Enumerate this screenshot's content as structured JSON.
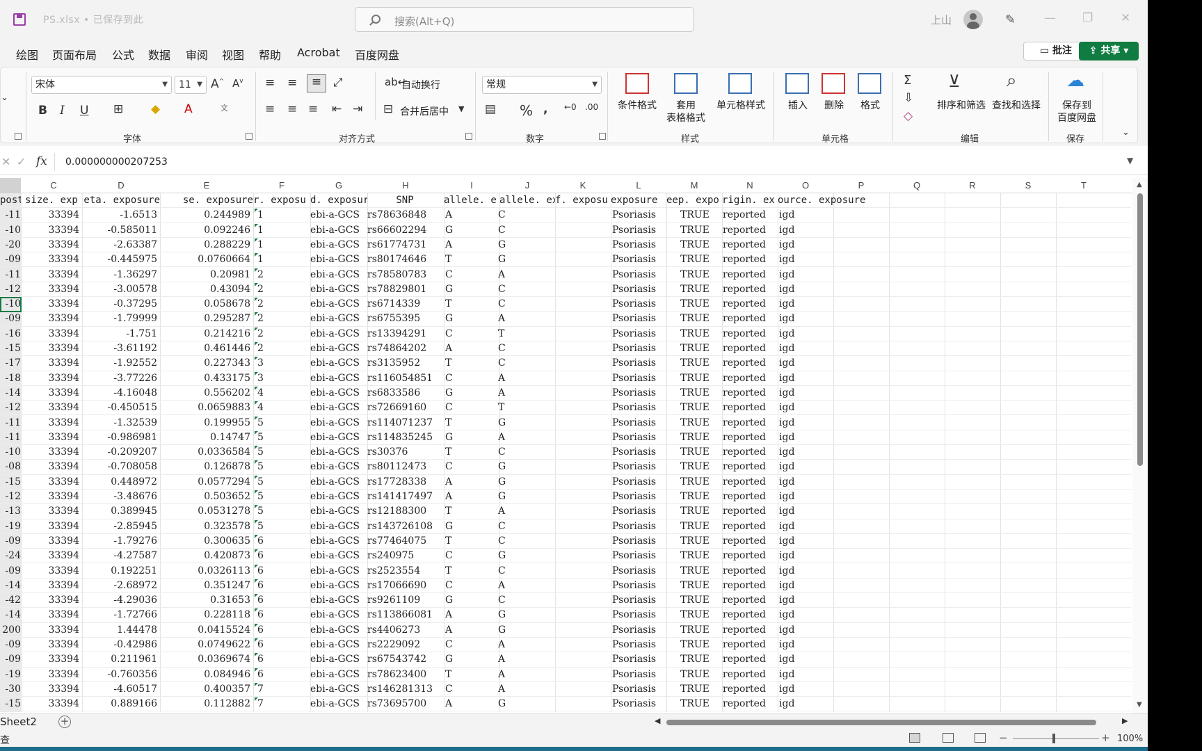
{
  "titlebar": {
    "file_title": "PS.xlsx • 已保存到此",
    "search_placeholder": "搜索(Alt+Q)",
    "user_name": "上山"
  },
  "menu": {
    "tabs": [
      "绘图",
      "页面布局",
      "公式",
      "数据",
      "审阅",
      "视图",
      "帮助",
      "Acrobat",
      "百度网盘"
    ],
    "comment_label": "批注",
    "share_label": "共享"
  },
  "ribbon": {
    "font_name": "宋体",
    "font_size": "11",
    "number_format": "常规",
    "wrap_text": "自动换行",
    "merge_center": "合并后居中",
    "conditional_format": "条件格式",
    "table_format_1": "套用",
    "table_format_2": "表格格式",
    "cell_styles": "单元格样式",
    "insert": "插入",
    "delete": "删除",
    "format": "格式",
    "sort_filter": "排序和筛选",
    "find_select": "查找和选择",
    "save_to_1": "保存到",
    "save_to_2": "百度网盘",
    "groups": {
      "font": "字体",
      "alignment": "对齐方式",
      "number": "数字",
      "styles": "样式",
      "cells": "单元格",
      "editing": "编辑",
      "save": "保存"
    }
  },
  "formula": {
    "value": "0.000000000207253"
  },
  "columns": [
    "C",
    "D",
    "E",
    "F",
    "G",
    "H",
    "I",
    "J",
    "K",
    "L",
    "M",
    "N",
    "O",
    "P",
    "Q",
    "R",
    "S",
    "T"
  ],
  "header_row": {
    "b": "poste",
    "c": "size. exp",
    "d": "eta. exposure",
    "e": "se. exposure",
    "f": "r. exposu",
    "g": "d. exposur",
    "h": "SNP",
    "i": "allele. e",
    "j": "allele. ex",
    "k": "f. exposu",
    "l": "exposure",
    "m": "eep. expo",
    "n": "rigin. ex",
    "o": "ource. exposure"
  },
  "rows": [
    [
      "-11",
      "33394",
      "-1.6513",
      "0.244989",
      "1",
      "ebi-a-GCS",
      "rs78636848",
      "A",
      "C",
      "Psoriasis",
      "TRUE",
      "reported",
      "igd"
    ],
    [
      "-10",
      "33394",
      "-0.585011",
      "0.092246",
      "1",
      "ebi-a-GCS",
      "rs66602294",
      "G",
      "C",
      "Psoriasis",
      "TRUE",
      "reported",
      "igd"
    ],
    [
      "-20",
      "33394",
      "-2.63387",
      "0.288229",
      "1",
      "ebi-a-GCS",
      "rs61774731",
      "A",
      "G",
      "Psoriasis",
      "TRUE",
      "reported",
      "igd"
    ],
    [
      "-09",
      "33394",
      "-0.445975",
      "0.0760664",
      "1",
      "ebi-a-GCS",
      "rs80174646",
      "T",
      "G",
      "Psoriasis",
      "TRUE",
      "reported",
      "igd"
    ],
    [
      "-11",
      "33394",
      "-1.36297",
      "0.20981",
      "2",
      "ebi-a-GCS",
      "rs78580783",
      "C",
      "A",
      "Psoriasis",
      "TRUE",
      "reported",
      "igd"
    ],
    [
      "-12",
      "33394",
      "-3.00578",
      "0.43094",
      "2",
      "ebi-a-GCS",
      "rs78829801",
      "G",
      "C",
      "Psoriasis",
      "TRUE",
      "reported",
      "igd"
    ],
    [
      "-10",
      "33394",
      "-0.37295",
      "0.058678",
      "2",
      "ebi-a-GCS",
      "rs6714339",
      "T",
      "C",
      "Psoriasis",
      "TRUE",
      "reported",
      "igd"
    ],
    [
      "-09",
      "33394",
      "-1.79999",
      "0.295287",
      "2",
      "ebi-a-GCS",
      "rs6755395",
      "G",
      "A",
      "Psoriasis",
      "TRUE",
      "reported",
      "igd"
    ],
    [
      "-16",
      "33394",
      "-1.751",
      "0.214216",
      "2",
      "ebi-a-GCS",
      "rs13394291",
      "C",
      "T",
      "Psoriasis",
      "TRUE",
      "reported",
      "igd"
    ],
    [
      "-15",
      "33394",
      "-3.61192",
      "0.461446",
      "2",
      "ebi-a-GCS",
      "rs74864202",
      "A",
      "C",
      "Psoriasis",
      "TRUE",
      "reported",
      "igd"
    ],
    [
      "-17",
      "33394",
      "-1.92552",
      "0.227343",
      "3",
      "ebi-a-GCS",
      "rs3135952",
      "T",
      "C",
      "Psoriasis",
      "TRUE",
      "reported",
      "igd"
    ],
    [
      "-18",
      "33394",
      "-3.77226",
      "0.433175",
      "3",
      "ebi-a-GCS",
      "rs116054851",
      "C",
      "A",
      "Psoriasis",
      "TRUE",
      "reported",
      "igd"
    ],
    [
      "-14",
      "33394",
      "-4.16048",
      "0.556202",
      "4",
      "ebi-a-GCS",
      "rs6833586",
      "G",
      "A",
      "Psoriasis",
      "TRUE",
      "reported",
      "igd"
    ],
    [
      "-12",
      "33394",
      "-0.450515",
      "0.0659883",
      "4",
      "ebi-a-GCS",
      "rs72669160",
      "C",
      "T",
      "Psoriasis",
      "TRUE",
      "reported",
      "igd"
    ],
    [
      "-11",
      "33394",
      "-1.32539",
      "0.199955",
      "5",
      "ebi-a-GCS",
      "rs114071237",
      "T",
      "G",
      "Psoriasis",
      "TRUE",
      "reported",
      "igd"
    ],
    [
      "-11",
      "33394",
      "-0.986981",
      "0.14747",
      "5",
      "ebi-a-GCS",
      "rs114835245",
      "G",
      "A",
      "Psoriasis",
      "TRUE",
      "reported",
      "igd"
    ],
    [
      "-10",
      "33394",
      "-0.209207",
      "0.0336584",
      "5",
      "ebi-a-GCS",
      "rs30376",
      "T",
      "C",
      "Psoriasis",
      "TRUE",
      "reported",
      "igd"
    ],
    [
      "-08",
      "33394",
      "-0.708058",
      "0.126878",
      "5",
      "ebi-a-GCS",
      "rs80112473",
      "C",
      "G",
      "Psoriasis",
      "TRUE",
      "reported",
      "igd"
    ],
    [
      "-15",
      "33394",
      "0.448972",
      "0.0577294",
      "5",
      "ebi-a-GCS",
      "rs17728338",
      "A",
      "G",
      "Psoriasis",
      "TRUE",
      "reported",
      "igd"
    ],
    [
      "-12",
      "33394",
      "-3.48676",
      "0.503652",
      "5",
      "ebi-a-GCS",
      "rs141417497",
      "A",
      "G",
      "Psoriasis",
      "TRUE",
      "reported",
      "igd"
    ],
    [
      "-13",
      "33394",
      "0.389945",
      "0.0531278",
      "5",
      "ebi-a-GCS",
      "rs12188300",
      "T",
      "A",
      "Psoriasis",
      "TRUE",
      "reported",
      "igd"
    ],
    [
      "-19",
      "33394",
      "-2.85945",
      "0.323578",
      "5",
      "ebi-a-GCS",
      "rs143726108",
      "G",
      "C",
      "Psoriasis",
      "TRUE",
      "reported",
      "igd"
    ],
    [
      "-09",
      "33394",
      "-1.79276",
      "0.300635",
      "6",
      "ebi-a-GCS",
      "rs77464075",
      "T",
      "C",
      "Psoriasis",
      "TRUE",
      "reported",
      "igd"
    ],
    [
      "-24",
      "33394",
      "-4.27587",
      "0.420873",
      "6",
      "ebi-a-GCS",
      "rs240975",
      "C",
      "G",
      "Psoriasis",
      "TRUE",
      "reported",
      "igd"
    ],
    [
      "-09",
      "33394",
      "0.192251",
      "0.0326113",
      "6",
      "ebi-a-GCS",
      "rs2523554",
      "T",
      "C",
      "Psoriasis",
      "TRUE",
      "reported",
      "igd"
    ],
    [
      "-14",
      "33394",
      "-2.68972",
      "0.351247",
      "6",
      "ebi-a-GCS",
      "rs17066690",
      "C",
      "A",
      "Psoriasis",
      "TRUE",
      "reported",
      "igd"
    ],
    [
      "-42",
      "33394",
      "-4.29036",
      "0.31653",
      "6",
      "ebi-a-GCS",
      "rs9261109",
      "G",
      "C",
      "Psoriasis",
      "TRUE",
      "reported",
      "igd"
    ],
    [
      "-14",
      "33394",
      "-1.72766",
      "0.228118",
      "6",
      "ebi-a-GCS",
      "rs113866081",
      "A",
      "G",
      "Psoriasis",
      "TRUE",
      "reported",
      "igd"
    ],
    [
      "200",
      "33394",
      "1.44478",
      "0.0415524",
      "6",
      "ebi-a-GCS",
      "rs4406273",
      "A",
      "G",
      "Psoriasis",
      "TRUE",
      "reported",
      "igd"
    ],
    [
      "-09",
      "33394",
      "-0.42986",
      "0.0749622",
      "6",
      "ebi-a-GCS",
      "rs2229092",
      "C",
      "A",
      "Psoriasis",
      "TRUE",
      "reported",
      "igd"
    ],
    [
      "-09",
      "33394",
      "0.211961",
      "0.0369674",
      "6",
      "ebi-a-GCS",
      "rs67543742",
      "G",
      "A",
      "Psoriasis",
      "TRUE",
      "reported",
      "igd"
    ],
    [
      "-19",
      "33394",
      "-0.760356",
      "0.084946",
      "6",
      "ebi-a-GCS",
      "rs78623400",
      "T",
      "A",
      "Psoriasis",
      "TRUE",
      "reported",
      "igd"
    ],
    [
      "-30",
      "33394",
      "-4.60517",
      "0.400357",
      "7",
      "ebi-a-GCS",
      "rs146281313",
      "C",
      "A",
      "Psoriasis",
      "TRUE",
      "reported",
      "igd"
    ],
    [
      "-15",
      "33394",
      "0.889166",
      "0.112882",
      "7",
      "ebi-a-GCS",
      "rs73695700",
      "A",
      "G",
      "Psoriasis",
      "TRUE",
      "reported",
      "igd"
    ]
  ],
  "sheet": {
    "tab_label": "Sheet2"
  },
  "status": {
    "ready": "查",
    "zoom": "100%"
  },
  "colors": {
    "accent": "#107c41",
    "save_icon": "#9b3ea8"
  }
}
